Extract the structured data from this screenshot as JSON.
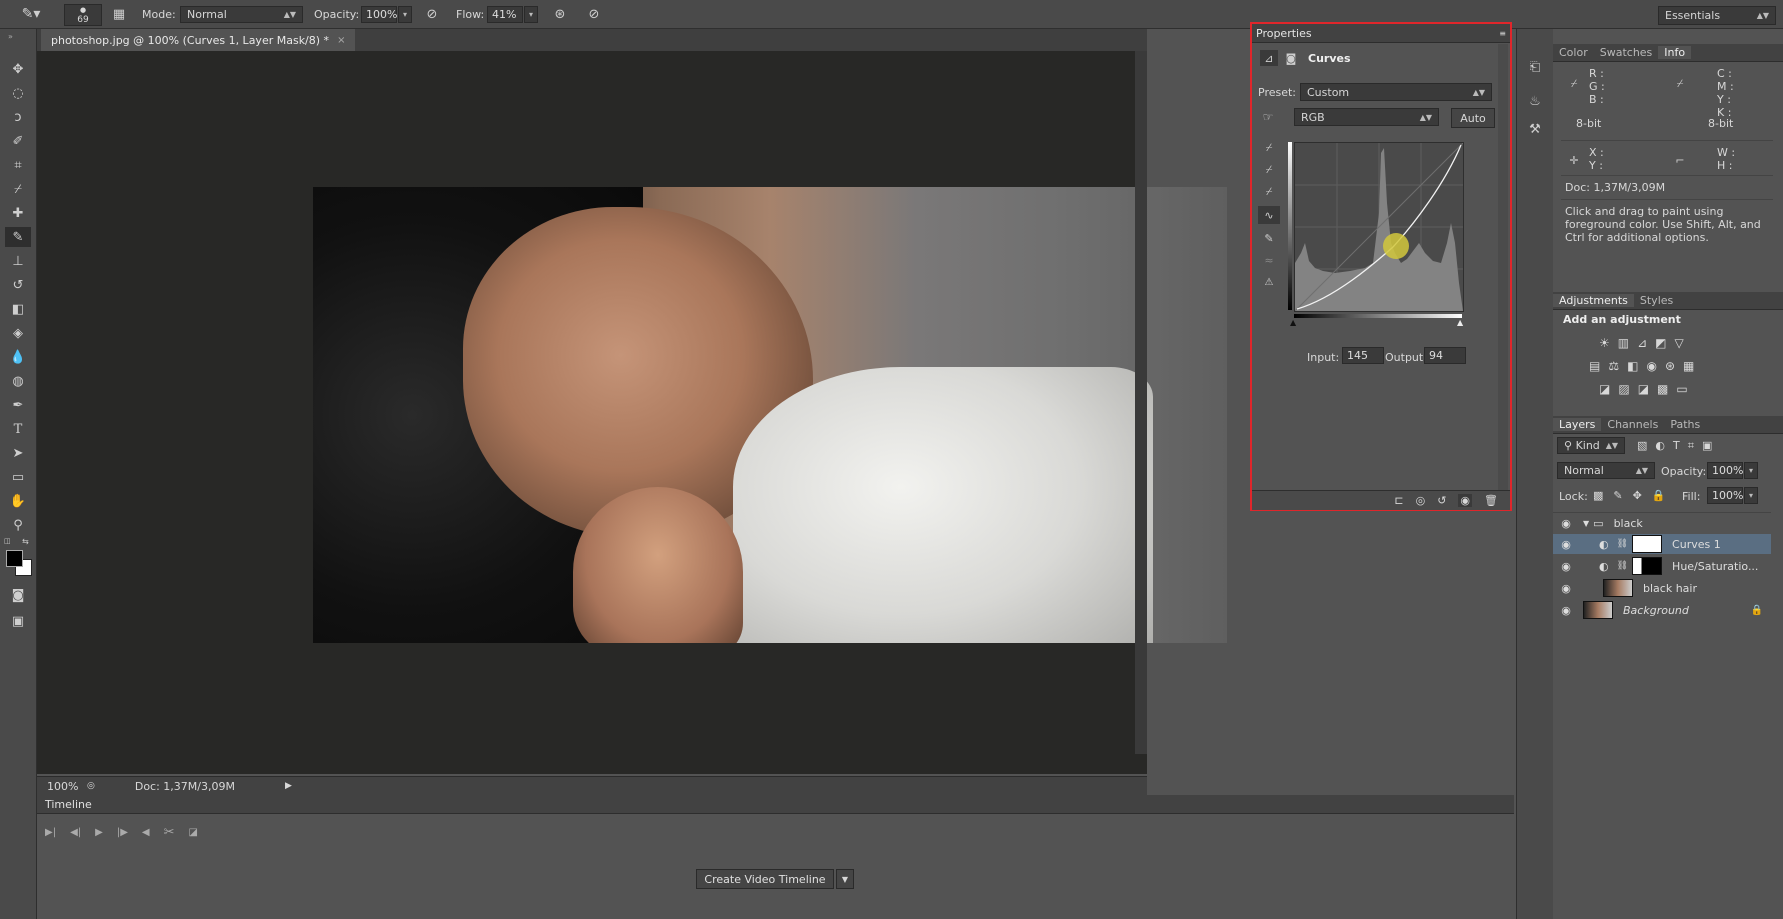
{
  "options_bar": {
    "brush_size": "69",
    "mode_label": "Mode:",
    "mode_value": "Normal",
    "opacity_label": "Opacity:",
    "opacity_value": "100%",
    "flow_label": "Flow:",
    "flow_value": "41%",
    "workspace": "Essentials"
  },
  "document": {
    "tab_title": "photoshop.jpg @ 100% (Curves 1, Layer Mask/8) *",
    "zoom": "100%",
    "doc_size": "Doc: 1,37M/3,09M"
  },
  "timeline": {
    "title": "Timeline",
    "create_button": "Create Video Timeline"
  },
  "properties": {
    "title": "Properties",
    "adjustment": "Curves",
    "preset_label": "Preset:",
    "preset_value": "Custom",
    "channel_value": "RGB",
    "auto_label": "Auto",
    "input_label": "Input:",
    "input_value": "145",
    "output_label": "Output:",
    "output_value": "94"
  },
  "info_panel": {
    "tabs": [
      "Color",
      "Swatches",
      "Info"
    ],
    "r": "R :",
    "g": "G :",
    "b": "B :",
    "bit_left": "8-bit",
    "c": "C :",
    "m": "M :",
    "y": "Y :",
    "k": "K :",
    "bit_right": "8-bit",
    "x": "X :",
    "yy": "Y :",
    "w": "W :",
    "h": "H :",
    "doc": "Doc: 1,37M/3,09M",
    "hint": "Click and drag to paint using foreground color.  Use Shift, Alt, and Ctrl for additional options."
  },
  "adjustments_panel": {
    "tabs": [
      "Adjustments",
      "Styles"
    ],
    "heading": "Add an adjustment"
  },
  "layers_panel": {
    "tabs": [
      "Layers",
      "Channels",
      "Paths"
    ],
    "filter_kind": "Kind",
    "blend_mode": "Normal",
    "opacity_label": "Opacity:",
    "opacity_value": "100%",
    "lock_label": "Lock:",
    "fill_label": "Fill:",
    "fill_value": "100%",
    "layers": [
      {
        "name": "black"
      },
      {
        "name": "Curves 1"
      },
      {
        "name": "Hue/Saturatio..."
      },
      {
        "name": "black hair"
      },
      {
        "name": "Background"
      }
    ]
  },
  "colors": {
    "app_bg": "#535353",
    "canvas_bg": "#282826",
    "panel_bg": "#535353",
    "highlight_border": "#e0262b",
    "selected_layer": "#5a6e82"
  }
}
